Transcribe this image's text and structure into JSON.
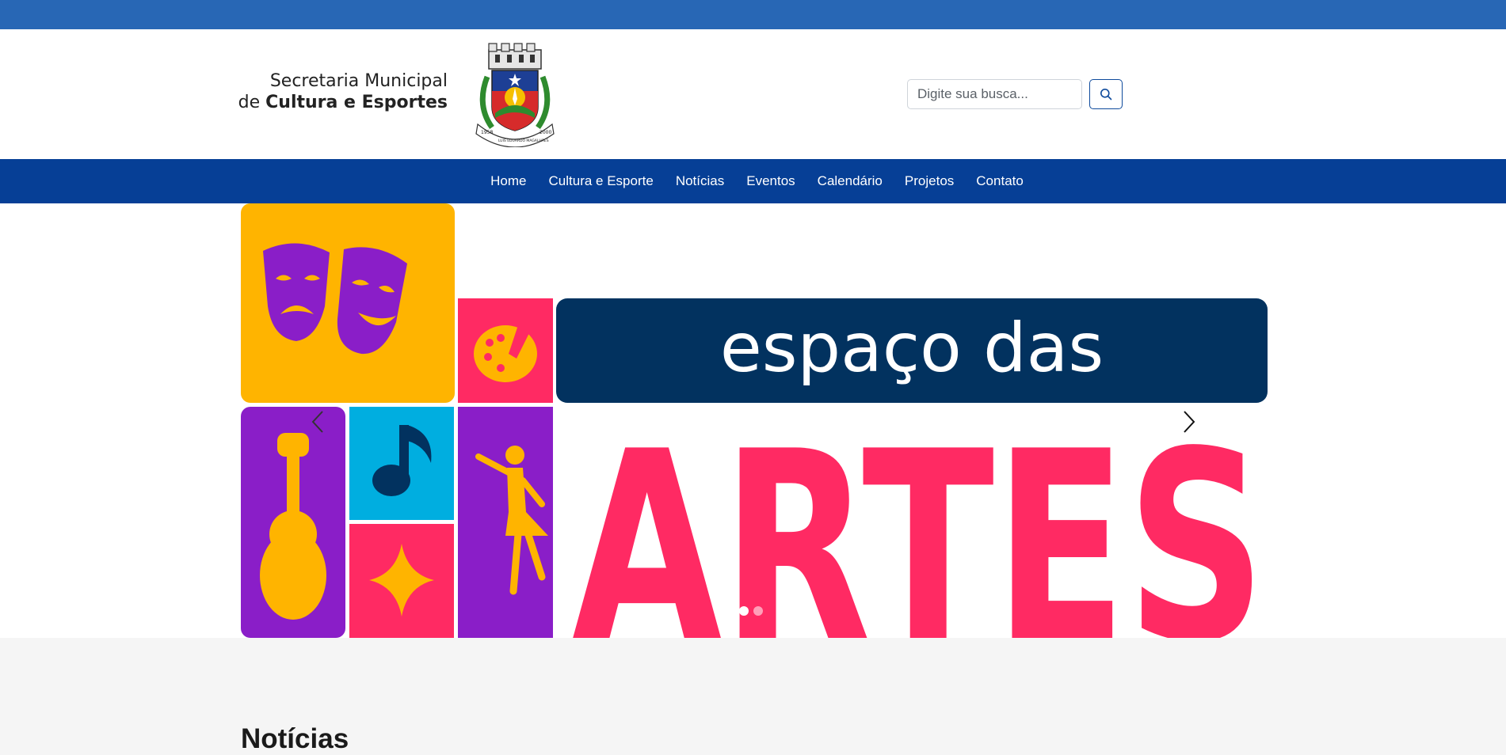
{
  "header": {
    "brand_line1": "Secretaria Municipal",
    "brand_line2_prefix": "de ",
    "brand_line2_bold": "Cultura e Esportes",
    "crest_lettering": "LUIS EDUARDO MAGALHÃES 1958 2000"
  },
  "search": {
    "placeholder": "Digite sua busca...",
    "icon": "search-icon"
  },
  "nav": {
    "items": [
      {
        "label": "Home"
      },
      {
        "label": "Cultura e Esporte"
      },
      {
        "label": "Notícias"
      },
      {
        "label": "Eventos"
      },
      {
        "label": "Calendário"
      },
      {
        "label": "Projetos"
      },
      {
        "label": "Contato"
      }
    ]
  },
  "carousel": {
    "banner_line1": "espaço das",
    "banner_line2": "ARTES",
    "slide_count": 2,
    "active_slide": 1,
    "prev_icon": "chevron-left-icon",
    "next_icon": "chevron-right-icon"
  },
  "section": {
    "title": "Notícias"
  },
  "colors": {
    "topbar": "#2867b5",
    "navbar": "#063f96",
    "banner_navy": "#02325f",
    "banner_pink": "#ff2a63",
    "banner_purple": "#8a1ec8",
    "banner_yellow": "#ffb400",
    "banner_cyan": "#00aee0"
  }
}
